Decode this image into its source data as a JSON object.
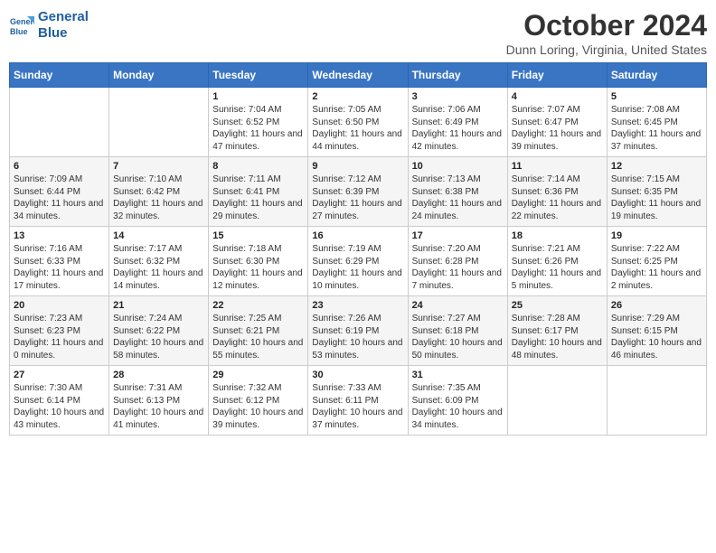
{
  "header": {
    "logo_line1": "General",
    "logo_line2": "Blue",
    "title": "October 2024",
    "subtitle": "Dunn Loring, Virginia, United States"
  },
  "weekdays": [
    "Sunday",
    "Monday",
    "Tuesday",
    "Wednesday",
    "Thursday",
    "Friday",
    "Saturday"
  ],
  "weeks": [
    [
      {
        "day": "",
        "sunrise": "",
        "sunset": "",
        "daylight": ""
      },
      {
        "day": "",
        "sunrise": "",
        "sunset": "",
        "daylight": ""
      },
      {
        "day": "1",
        "sunrise": "Sunrise: 7:04 AM",
        "sunset": "Sunset: 6:52 PM",
        "daylight": "Daylight: 11 hours and 47 minutes."
      },
      {
        "day": "2",
        "sunrise": "Sunrise: 7:05 AM",
        "sunset": "Sunset: 6:50 PM",
        "daylight": "Daylight: 11 hours and 44 minutes."
      },
      {
        "day": "3",
        "sunrise": "Sunrise: 7:06 AM",
        "sunset": "Sunset: 6:49 PM",
        "daylight": "Daylight: 11 hours and 42 minutes."
      },
      {
        "day": "4",
        "sunrise": "Sunrise: 7:07 AM",
        "sunset": "Sunset: 6:47 PM",
        "daylight": "Daylight: 11 hours and 39 minutes."
      },
      {
        "day": "5",
        "sunrise": "Sunrise: 7:08 AM",
        "sunset": "Sunset: 6:45 PM",
        "daylight": "Daylight: 11 hours and 37 minutes."
      }
    ],
    [
      {
        "day": "6",
        "sunrise": "Sunrise: 7:09 AM",
        "sunset": "Sunset: 6:44 PM",
        "daylight": "Daylight: 11 hours and 34 minutes."
      },
      {
        "day": "7",
        "sunrise": "Sunrise: 7:10 AM",
        "sunset": "Sunset: 6:42 PM",
        "daylight": "Daylight: 11 hours and 32 minutes."
      },
      {
        "day": "8",
        "sunrise": "Sunrise: 7:11 AM",
        "sunset": "Sunset: 6:41 PM",
        "daylight": "Daylight: 11 hours and 29 minutes."
      },
      {
        "day": "9",
        "sunrise": "Sunrise: 7:12 AM",
        "sunset": "Sunset: 6:39 PM",
        "daylight": "Daylight: 11 hours and 27 minutes."
      },
      {
        "day": "10",
        "sunrise": "Sunrise: 7:13 AM",
        "sunset": "Sunset: 6:38 PM",
        "daylight": "Daylight: 11 hours and 24 minutes."
      },
      {
        "day": "11",
        "sunrise": "Sunrise: 7:14 AM",
        "sunset": "Sunset: 6:36 PM",
        "daylight": "Daylight: 11 hours and 22 minutes."
      },
      {
        "day": "12",
        "sunrise": "Sunrise: 7:15 AM",
        "sunset": "Sunset: 6:35 PM",
        "daylight": "Daylight: 11 hours and 19 minutes."
      }
    ],
    [
      {
        "day": "13",
        "sunrise": "Sunrise: 7:16 AM",
        "sunset": "Sunset: 6:33 PM",
        "daylight": "Daylight: 11 hours and 17 minutes."
      },
      {
        "day": "14",
        "sunrise": "Sunrise: 7:17 AM",
        "sunset": "Sunset: 6:32 PM",
        "daylight": "Daylight: 11 hours and 14 minutes."
      },
      {
        "day": "15",
        "sunrise": "Sunrise: 7:18 AM",
        "sunset": "Sunset: 6:30 PM",
        "daylight": "Daylight: 11 hours and 12 minutes."
      },
      {
        "day": "16",
        "sunrise": "Sunrise: 7:19 AM",
        "sunset": "Sunset: 6:29 PM",
        "daylight": "Daylight: 11 hours and 10 minutes."
      },
      {
        "day": "17",
        "sunrise": "Sunrise: 7:20 AM",
        "sunset": "Sunset: 6:28 PM",
        "daylight": "Daylight: 11 hours and 7 minutes."
      },
      {
        "day": "18",
        "sunrise": "Sunrise: 7:21 AM",
        "sunset": "Sunset: 6:26 PM",
        "daylight": "Daylight: 11 hours and 5 minutes."
      },
      {
        "day": "19",
        "sunrise": "Sunrise: 7:22 AM",
        "sunset": "Sunset: 6:25 PM",
        "daylight": "Daylight: 11 hours and 2 minutes."
      }
    ],
    [
      {
        "day": "20",
        "sunrise": "Sunrise: 7:23 AM",
        "sunset": "Sunset: 6:23 PM",
        "daylight": "Daylight: 11 hours and 0 minutes."
      },
      {
        "day": "21",
        "sunrise": "Sunrise: 7:24 AM",
        "sunset": "Sunset: 6:22 PM",
        "daylight": "Daylight: 10 hours and 58 minutes."
      },
      {
        "day": "22",
        "sunrise": "Sunrise: 7:25 AM",
        "sunset": "Sunset: 6:21 PM",
        "daylight": "Daylight: 10 hours and 55 minutes."
      },
      {
        "day": "23",
        "sunrise": "Sunrise: 7:26 AM",
        "sunset": "Sunset: 6:19 PM",
        "daylight": "Daylight: 10 hours and 53 minutes."
      },
      {
        "day": "24",
        "sunrise": "Sunrise: 7:27 AM",
        "sunset": "Sunset: 6:18 PM",
        "daylight": "Daylight: 10 hours and 50 minutes."
      },
      {
        "day": "25",
        "sunrise": "Sunrise: 7:28 AM",
        "sunset": "Sunset: 6:17 PM",
        "daylight": "Daylight: 10 hours and 48 minutes."
      },
      {
        "day": "26",
        "sunrise": "Sunrise: 7:29 AM",
        "sunset": "Sunset: 6:15 PM",
        "daylight": "Daylight: 10 hours and 46 minutes."
      }
    ],
    [
      {
        "day": "27",
        "sunrise": "Sunrise: 7:30 AM",
        "sunset": "Sunset: 6:14 PM",
        "daylight": "Daylight: 10 hours and 43 minutes."
      },
      {
        "day": "28",
        "sunrise": "Sunrise: 7:31 AM",
        "sunset": "Sunset: 6:13 PM",
        "daylight": "Daylight: 10 hours and 41 minutes."
      },
      {
        "day": "29",
        "sunrise": "Sunrise: 7:32 AM",
        "sunset": "Sunset: 6:12 PM",
        "daylight": "Daylight: 10 hours and 39 minutes."
      },
      {
        "day": "30",
        "sunrise": "Sunrise: 7:33 AM",
        "sunset": "Sunset: 6:11 PM",
        "daylight": "Daylight: 10 hours and 37 minutes."
      },
      {
        "day": "31",
        "sunrise": "Sunrise: 7:35 AM",
        "sunset": "Sunset: 6:09 PM",
        "daylight": "Daylight: 10 hours and 34 minutes."
      },
      {
        "day": "",
        "sunrise": "",
        "sunset": "",
        "daylight": ""
      },
      {
        "day": "",
        "sunrise": "",
        "sunset": "",
        "daylight": ""
      }
    ]
  ]
}
